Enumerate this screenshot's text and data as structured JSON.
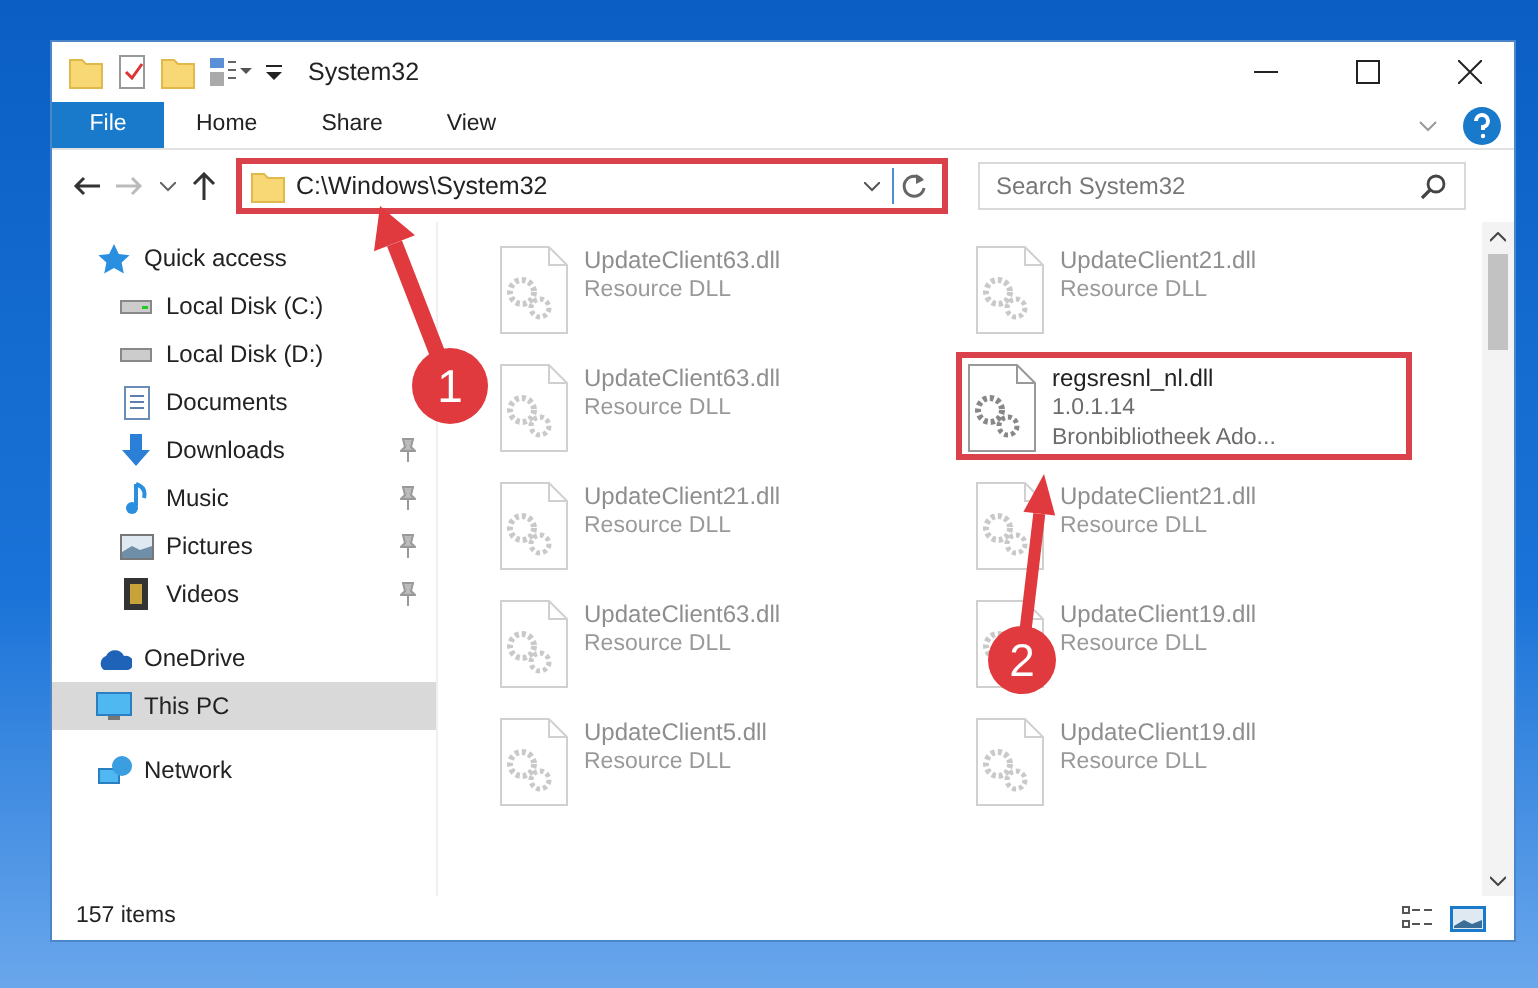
{
  "window": {
    "title": "System32"
  },
  "ribbon_tabs": [
    {
      "label": "File",
      "selected": true
    },
    {
      "label": "Home",
      "selected": false
    },
    {
      "label": "Share",
      "selected": false
    },
    {
      "label": "View",
      "selected": false
    }
  ],
  "address_bar": {
    "path": "C:\\Windows\\System32",
    "highlighted": true
  },
  "search": {
    "placeholder": "Search System32"
  },
  "navigation": [
    {
      "label": "Quick access",
      "selected": false,
      "children": [
        {
          "label": "Local Disk (C:)",
          "pinned": false,
          "selected": false
        },
        {
          "label": "Local Disk (D:)",
          "pinned": false,
          "selected": false
        },
        {
          "label": "Documents",
          "pinned": false,
          "selected": false
        },
        {
          "label": "Downloads",
          "pinned": true,
          "selected": false
        },
        {
          "label": "Music",
          "pinned": true,
          "selected": false
        },
        {
          "label": "Pictures",
          "pinned": true,
          "selected": false
        },
        {
          "label": "Videos",
          "pinned": true,
          "selected": false
        }
      ]
    },
    {
      "label": "OneDrive",
      "selected": false
    },
    {
      "label": "This PC",
      "selected": true
    },
    {
      "label": "Network",
      "selected": false
    }
  ],
  "files": [
    {
      "name": "UpdateClient63.dll",
      "details": [
        "Resource DLL"
      ],
      "highlighted": false
    },
    {
      "name": "UpdateClient21.dll",
      "details": [
        "Resource DLL"
      ],
      "highlighted": false
    },
    {
      "name": "UpdateClient63.dll",
      "details": [
        "Resource DLL"
      ],
      "highlighted": false
    },
    {
      "name": "regsresnl_nl.dll",
      "details": [
        "1.0.1.14",
        "Bronbibliotheek Ado..."
      ],
      "highlighted": true
    },
    {
      "name": "UpdateClient21.dll",
      "details": [
        "Resource DLL"
      ],
      "highlighted": false
    },
    {
      "name": "UpdateClient21.dll",
      "details": [
        "Resource DLL"
      ],
      "highlighted": false
    },
    {
      "name": "UpdateClient63.dll",
      "details": [
        "Resource DLL"
      ],
      "highlighted": false
    },
    {
      "name": "UpdateClient19.dll",
      "details": [
        "Resource DLL"
      ],
      "highlighted": false
    },
    {
      "name": "UpdateClient5.dll",
      "details": [
        "Resource DLL"
      ],
      "highlighted": false
    },
    {
      "name": "UpdateClient19.dll",
      "details": [
        "Resource DLL"
      ],
      "highlighted": false
    }
  ],
  "status_bar": {
    "item_count": "157 items"
  },
  "callouts": [
    {
      "label": "1"
    },
    {
      "label": "2"
    }
  ]
}
